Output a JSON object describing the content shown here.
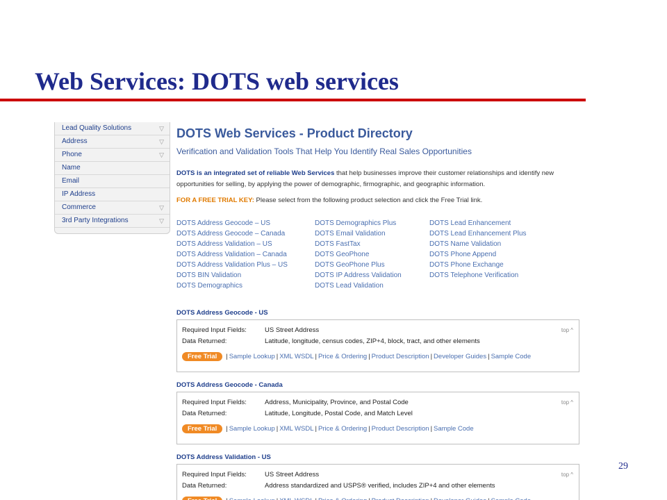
{
  "slide": {
    "title": "Web Services: DOTS web services",
    "page_number": "29"
  },
  "sidebar": {
    "items": [
      {
        "label": "Lead Quality Solutions",
        "has_chevron": true
      },
      {
        "label": "Address",
        "has_chevron": true
      },
      {
        "label": "Phone",
        "has_chevron": true
      },
      {
        "label": "Name",
        "has_chevron": false
      },
      {
        "label": "Email",
        "has_chevron": false
      },
      {
        "label": "IP Address",
        "has_chevron": false
      },
      {
        "label": "Commerce",
        "has_chevron": true
      },
      {
        "label": "3rd Party Integrations",
        "has_chevron": true
      }
    ],
    "chevron_glyph": "▽"
  },
  "main": {
    "title": "DOTS Web Services - Product Directory",
    "subtitle": "Verification and Validation Tools That Help You Identify Real Sales Opportunities",
    "intro_bold": "DOTS is an integrated set of reliable Web Services",
    "intro_rest": " that help businesses improve their customer relationships and identify new opportunities for selling, by applying the power of demographic, firmographic, and geographic information.",
    "trial_key_label": "FOR A FREE TRIAL KEY:",
    "trial_key_text": " Please select from the following product selection and click the Free Trial link.",
    "links": {
      "col1": [
        "DOTS Address Geocode – US",
        "DOTS Address Geocode – Canada",
        "DOTS Address Validation – US",
        "DOTS Address Validation – Canada",
        "DOTS Address Validation Plus – US",
        "DOTS BIN Validation",
        "DOTS Demographics"
      ],
      "col2": [
        "DOTS Demographics Plus",
        "DOTS Email Validation",
        "DOTS FastTax",
        "DOTS GeoPhone",
        "DOTS GeoPhone Plus",
        "DOTS IP Address Validation",
        "DOTS Lead Validation"
      ],
      "col3": [
        "DOTS Lead Enhancement",
        "DOTS Lead Enhancement Plus",
        "DOTS Name Validation",
        "DOTS Phone Append",
        "DOTS Phone Exchange",
        "DOTS Telephone Verification"
      ]
    },
    "sections": [
      {
        "title": "DOTS Address Geocode - US",
        "req_label": "Required Input Fields:",
        "req_value": "US Street Address",
        "ret_label": "Data Returned:",
        "ret_value": "Latitude, longitude, census codes, ZIP+4, block, tract, and other elements",
        "top": "top ^",
        "free_trial": "Free Trial",
        "actions": [
          "Sample Lookup",
          "XML WSDL",
          "Price & Ordering",
          "Product Description",
          "Developer Guides",
          "Sample Code"
        ]
      },
      {
        "title": "DOTS Address Geocode - Canada",
        "req_label": "Required Input Fields:",
        "req_value": "Address, Municipality, Province, and Postal Code",
        "ret_label": "Data Returned:",
        "ret_value": "Latitude, Longitude, Postal Code, and Match Level",
        "top": "top ^",
        "free_trial": "Free Trial",
        "actions": [
          "Sample Lookup",
          "XML WSDL",
          "Price & Ordering",
          "Product Description",
          "Sample Code"
        ]
      },
      {
        "title": "DOTS Address Validation - US",
        "req_label": "Required Input Fields:",
        "req_value": "US Street Address",
        "ret_label": "Data Returned:",
        "ret_value": "Address standardized and USPS® verified, includes ZIP+4 and other elements",
        "top": "top ^",
        "free_trial": "Free Trial",
        "actions": [
          "Sample Lookup",
          "XML WSDL",
          "Price & Ordering",
          "Product Description",
          "Developer Guides",
          "Sample Code"
        ]
      }
    ]
  },
  "colors": {
    "title_blue": "#1f2a8c",
    "rule_red": "#cc0000",
    "link_blue": "#4a6fb0",
    "trial_orange": "#f08a24"
  }
}
